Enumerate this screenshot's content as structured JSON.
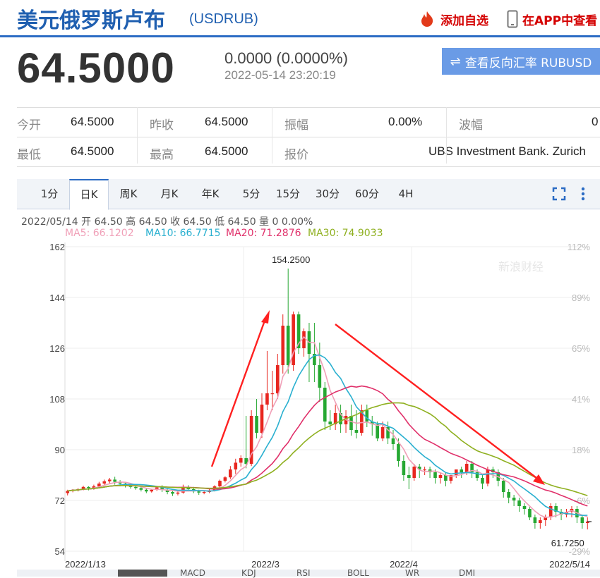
{
  "header": {
    "title": "美元俄罗斯卢布",
    "symbol": "(USDRUB)",
    "add_watch": "添加自选",
    "app_view": "在APP中查看"
  },
  "quote": {
    "price": "64.5000",
    "change": "0.0000 (0.0000%)",
    "time": "2022-05-14 23:20:19",
    "reverse_button": "查看反向汇率 RUBUSD"
  },
  "stats": {
    "open_label": "今开",
    "open": "64.5000",
    "prev_close_label": "昨收",
    "prev_close": "64.5000",
    "amplitude_label": "振幅",
    "amplitude": "0.00%",
    "wave_label": "波幅",
    "wave": "0",
    "low_label": "最低",
    "low": "64.5000",
    "high_label": "最高",
    "high": "64.5000",
    "quote_label": "报价",
    "quoter": "UBS Investment Bank. Zurich"
  },
  "tabs": [
    "1分",
    "日K",
    "周K",
    "月K",
    "年K",
    "5分",
    "15分",
    "30分",
    "60分",
    "4H"
  ],
  "active_tab": "日K",
  "info_line": "2022/05/14 开 64.50 高 64.50 收 64.50 低 64.50 量 0 0.00%",
  "ma_legend": [
    {
      "label": "MA5: 66.1202",
      "color": "#f0a0b8"
    },
    {
      "label": "MA10: 66.7715",
      "color": "#2ab0d0"
    },
    {
      "label": "MA20: 71.2876",
      "color": "#e0306a"
    },
    {
      "label": "MA30: 74.9033",
      "color": "#8fb020"
    }
  ],
  "watermark": "新浪财经",
  "bottom_tabs": [
    "MACD",
    "KDJ",
    "RSI",
    "BOLL",
    "WR",
    "DMI"
  ],
  "chart_data": {
    "type": "candlestick",
    "y_ticks": [
      "162",
      "144",
      "126",
      "108",
      "90",
      "72",
      "54"
    ],
    "ylim": [
      54,
      162
    ],
    "right_ticks": [
      "112%",
      "89%",
      "65%",
      "41%",
      "18%",
      "-6%",
      "-29%"
    ],
    "x_labels": [
      "2022/1/13",
      "2022/3",
      "2022/4",
      "2022/5/14"
    ],
    "max_annotation": "154.2500",
    "min_annotation": "61.7250",
    "colors": {
      "up": "#e8261f",
      "down": "#26a832"
    },
    "candles": [
      [
        74.6,
        75.8,
        75.4,
        73.8
      ],
      [
        75.4,
        76.0,
        75.8,
        74.9
      ],
      [
        75.8,
        76.4,
        76.0,
        75.2
      ],
      [
        76.0,
        77.2,
        76.8,
        75.6
      ],
      [
        76.8,
        77.0,
        76.4,
        75.6
      ],
      [
        76.4,
        77.6,
        77.0,
        75.8
      ],
      [
        77.0,
        78.6,
        78.0,
        76.4
      ],
      [
        78.0,
        79.4,
        78.8,
        77.2
      ],
      [
        78.8,
        80.0,
        79.4,
        77.8
      ],
      [
        79.4,
        80.4,
        78.6,
        77.6
      ],
      [
        78.6,
        79.2,
        78.0,
        77.0
      ],
      [
        78.0,
        78.6,
        77.4,
        76.6
      ],
      [
        77.4,
        78.0,
        76.8,
        76.2
      ],
      [
        76.8,
        77.4,
        76.4,
        75.8
      ],
      [
        76.4,
        77.0,
        75.8,
        75.2
      ],
      [
        75.8,
        76.4,
        75.2,
        74.6
      ],
      [
        75.2,
        76.0,
        75.8,
        74.8
      ],
      [
        75.8,
        76.8,
        76.6,
        75.4
      ],
      [
        76.6,
        77.4,
        75.8,
        75.0
      ],
      [
        75.8,
        76.2,
        75.0,
        74.2
      ],
      [
        75.0,
        75.6,
        74.4,
        73.6
      ],
      [
        74.4,
        75.2,
        74.8,
        73.8
      ],
      [
        74.8,
        77.6,
        76.6,
        74.4
      ],
      [
        76.6,
        77.4,
        76.0,
        75.2
      ],
      [
        76.0,
        76.8,
        75.2,
        74.6
      ],
      [
        75.2,
        75.8,
        74.8,
        74.0
      ],
      [
        74.8,
        75.4,
        75.0,
        74.2
      ],
      [
        75.0,
        76.2,
        75.6,
        74.6
      ],
      [
        75.6,
        77.4,
        77.0,
        75.2
      ],
      [
        77.0,
        79.4,
        79.0,
        76.4
      ],
      [
        79.0,
        80.6,
        80.2,
        78.4
      ],
      [
        80.2,
        84.2,
        83.0,
        79.6
      ],
      [
        83.0,
        86.8,
        85.4,
        81.4
      ],
      [
        85.4,
        88.0,
        87.0,
        84.0
      ],
      [
        87.0,
        102.0,
        85.0,
        83.4
      ],
      [
        85.0,
        104.0,
        102.0,
        84.2
      ],
      [
        102.0,
        108.0,
        96.0,
        94.0
      ],
      [
        96.0,
        110.0,
        106.0,
        94.2
      ],
      [
        106.0,
        125.0,
        110.0,
        104.0
      ],
      [
        110.0,
        118.0,
        110.0,
        104.0
      ],
      [
        110.0,
        124.0,
        120.0,
        108.0
      ],
      [
        120.0,
        138.0,
        134.0,
        117.0
      ],
      [
        134.0,
        154.25,
        120.0,
        117.0
      ],
      [
        120.0,
        139.0,
        138.0,
        118.0
      ],
      [
        138.0,
        139.0,
        126.0,
        124.0
      ],
      [
        126.0,
        133.0,
        132.0,
        123.0
      ],
      [
        132.0,
        135.0,
        124.0,
        114.0
      ],
      [
        124.0,
        135.0,
        120.0,
        114.0
      ],
      [
        120.0,
        128.0,
        112.0,
        107.0
      ],
      [
        112.0,
        114.0,
        100.0,
        97.0
      ],
      [
        100.0,
        104.0,
        99.0,
        97.0
      ],
      [
        99.0,
        106.0,
        103.0,
        97.0
      ],
      [
        103.0,
        106.0,
        99.0,
        96.0
      ],
      [
        99.0,
        104.0,
        102.0,
        96.0
      ],
      [
        102.0,
        106.0,
        97.0,
        95.0
      ],
      [
        97.0,
        104.0,
        96.0,
        94.0
      ],
      [
        96.0,
        106.0,
        104.0,
        95.0
      ],
      [
        104.0,
        106.0,
        100.0,
        98.0
      ],
      [
        100.0,
        102.0,
        99.0,
        95.0
      ],
      [
        99.0,
        100.0,
        94.0,
        93.0
      ],
      [
        94.0,
        100.0,
        98.0,
        93.0
      ],
      [
        98.0,
        100.0,
        94.0,
        92.0
      ],
      [
        94.0,
        97.0,
        92.0,
        90.0
      ],
      [
        92.0,
        94.0,
        86.0,
        84.0
      ],
      [
        86.0,
        88.0,
        81.0,
        79.0
      ],
      [
        81.0,
        84.0,
        80.0,
        76.0
      ],
      [
        80.0,
        85.0,
        84.0,
        79.0
      ],
      [
        84.0,
        85.0,
        83.0,
        80.0
      ],
      [
        83.0,
        84.0,
        83.0,
        81.0
      ],
      [
        83.0,
        84.0,
        82.0,
        80.0
      ],
      [
        82.0,
        83.0,
        80.0,
        78.0
      ],
      [
        80.0,
        82.0,
        81.0,
        78.0
      ],
      [
        81.0,
        82.0,
        79.0,
        77.0
      ],
      [
        79.0,
        80.0,
        81.0,
        78.0
      ],
      [
        81.0,
        83.0,
        83.0,
        80.0
      ],
      [
        83.0,
        84.0,
        82.0,
        80.0
      ],
      [
        82.0,
        86.0,
        85.0,
        81.0
      ],
      [
        85.0,
        86.0,
        82.0,
        80.0
      ],
      [
        82.0,
        83.0,
        80.0,
        79.0
      ],
      [
        80.0,
        81.0,
        78.0,
        76.0
      ],
      [
        78.0,
        84.0,
        83.0,
        77.0
      ],
      [
        83.0,
        84.0,
        82.0,
        80.0
      ],
      [
        82.0,
        83.0,
        79.0,
        77.0
      ],
      [
        79.0,
        80.0,
        75.0,
        73.0
      ],
      [
        75.0,
        76.0,
        73.0,
        71.0
      ],
      [
        73.0,
        74.0,
        72.0,
        70.0
      ],
      [
        72.0,
        73.0,
        70.0,
        68.0
      ],
      [
        70.0,
        71.0,
        69.0,
        67.0
      ],
      [
        69.0,
        70.0,
        66.0,
        65.0
      ],
      [
        66.0,
        67.0,
        64.0,
        62.0
      ],
      [
        64.0,
        66.0,
        65.0,
        62.0
      ],
      [
        65.0,
        67.0,
        66.0,
        63.0
      ],
      [
        66.0,
        71.0,
        70.0,
        65.0
      ],
      [
        70.0,
        71.0,
        68.0,
        66.0
      ],
      [
        68.0,
        69.0,
        67.0,
        65.0
      ],
      [
        67.0,
        69.0,
        68.0,
        66.0
      ],
      [
        68.0,
        70.0,
        69.0,
        66.0
      ],
      [
        69.0,
        70.0,
        66.0,
        64.0
      ],
      [
        66.0,
        67.0,
        64.0,
        62.0
      ],
      [
        64.0,
        66.0,
        64.5,
        61.725
      ]
    ]
  }
}
